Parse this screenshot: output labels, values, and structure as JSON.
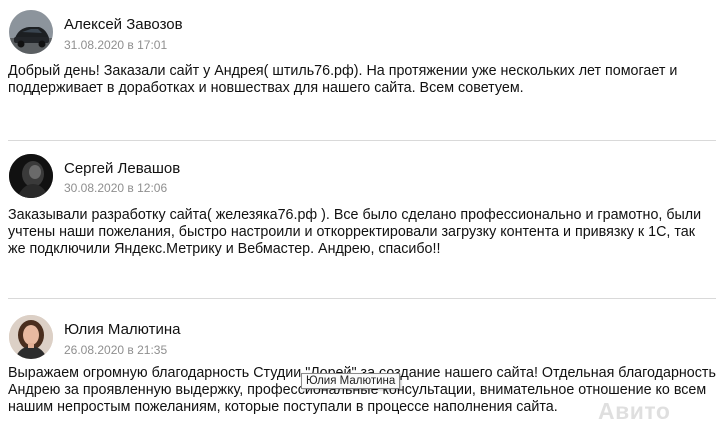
{
  "reviews": [
    {
      "author": "Алексей Завозов",
      "date": "31.08.2020 в 17:01",
      "text": "Добрый день! Заказали сайт у Андрея( штиль76.рф). На протяжении уже нескольких лет помогает и поддерживает в доработках и новшествах для нашего сайта. Всем советуем."
    },
    {
      "author": "Сергей Левашов",
      "date": "30.08.2020 в 12:06",
      "text": "Заказывали разработку сайта( железяка76.рф ). Все было сделано профессионально и грамотно, были учтены наши пожелания, быстро настроили и откорректировали загрузку контента и привязку к 1С, так же подключили Яндекс.Метрику и Вебмастер. Андрею, спасибо!!"
    },
    {
      "author": "Юлия Малютина",
      "date": "26.08.2020 в 21:35",
      "text": "Выражаем огромную благодарность Студии \"Лорей\" за создание нашего сайта! Отдельная благодарность Андрею за проявленную выдержку, профессиональные консультации, внимательное отношение ко всем нашим непростым пожеланиям, которые поступали в процессе наполнения сайта."
    }
  ],
  "tooltip": "Юлия Малютина",
  "watermark": "Авито"
}
